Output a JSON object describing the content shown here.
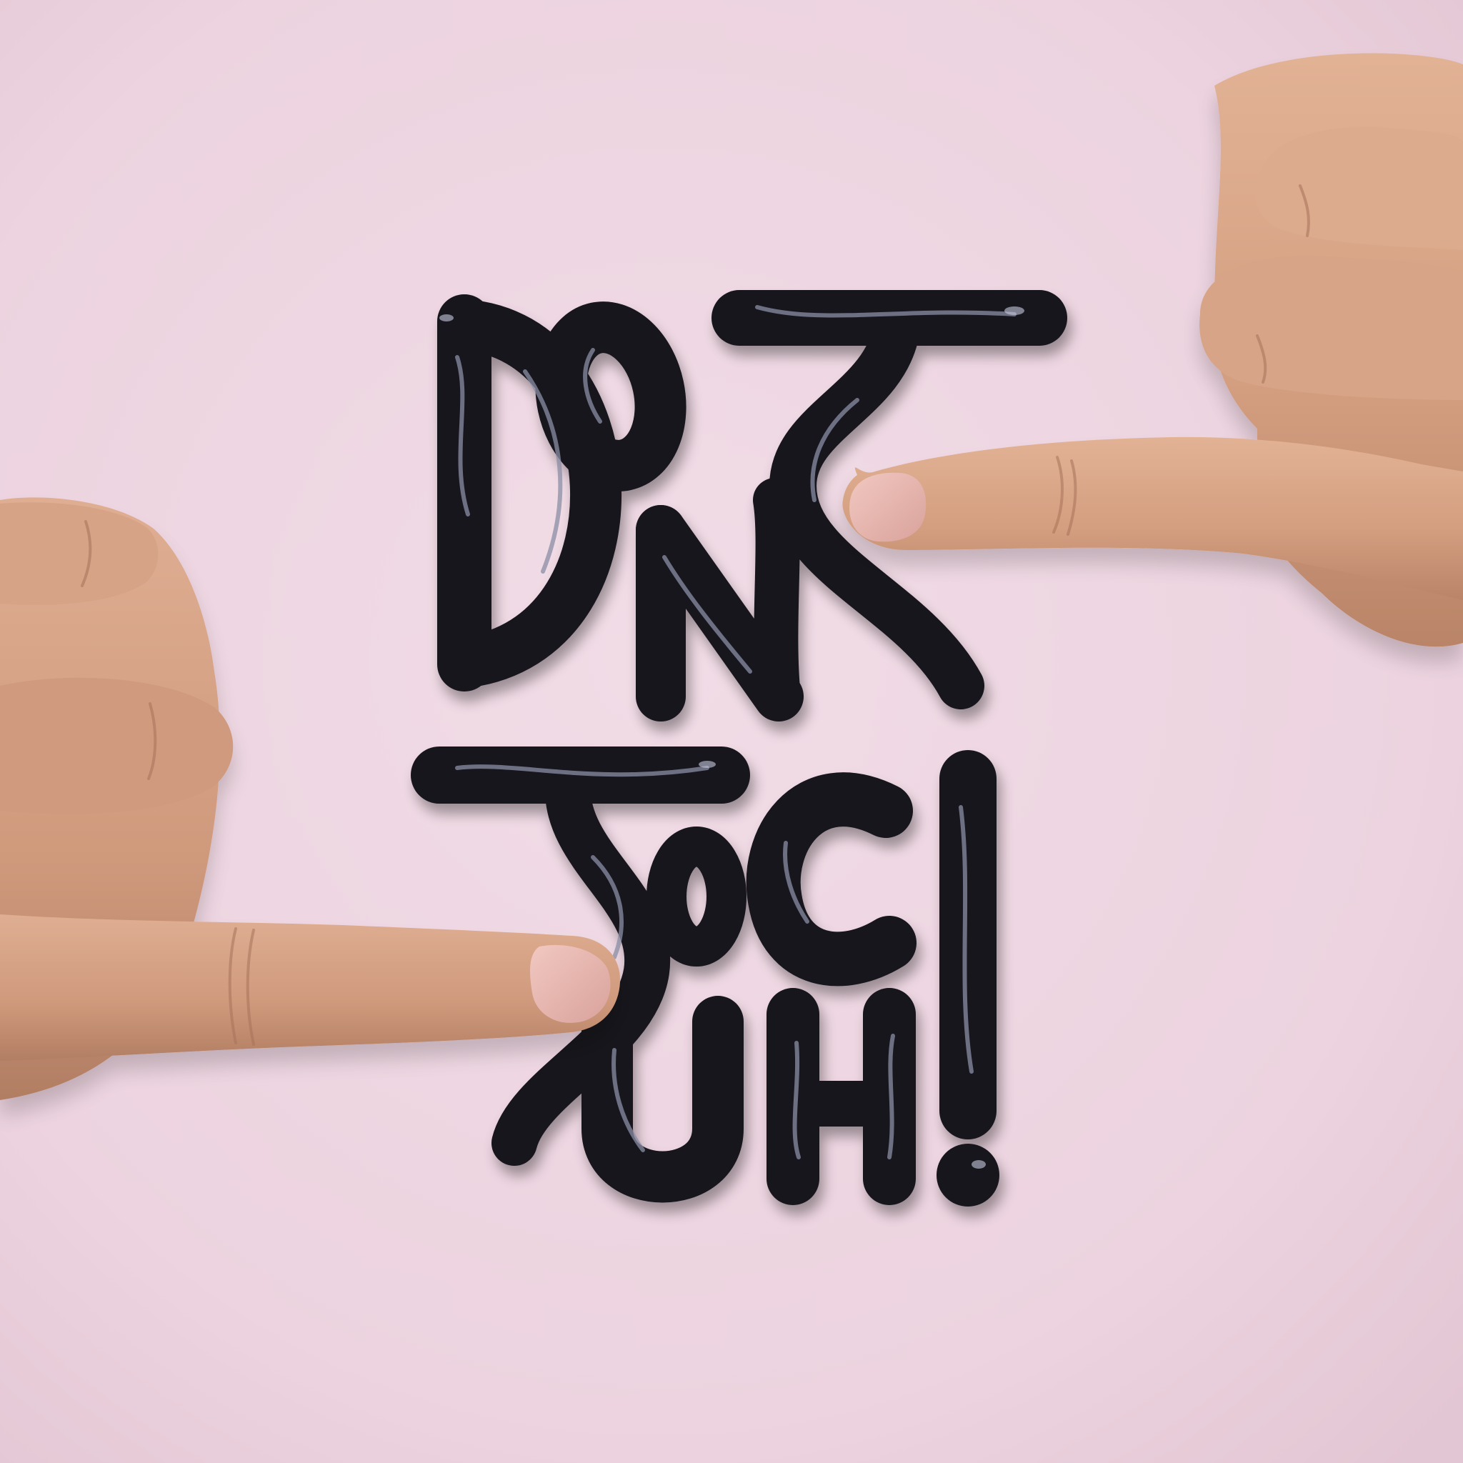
{
  "artwork": {
    "lettering": "DONT TOUCH!",
    "background_color": "#eed7e2",
    "lettering_color": "#17141f",
    "lettering_highlight_color": "#8b8ea6",
    "skin_color": "#d9a384",
    "nail_color": "#e4b2ac",
    "elements": {
      "right_hand": "pointing-hand-from-right",
      "left_hand": "pointing-hand-from-left"
    }
  }
}
